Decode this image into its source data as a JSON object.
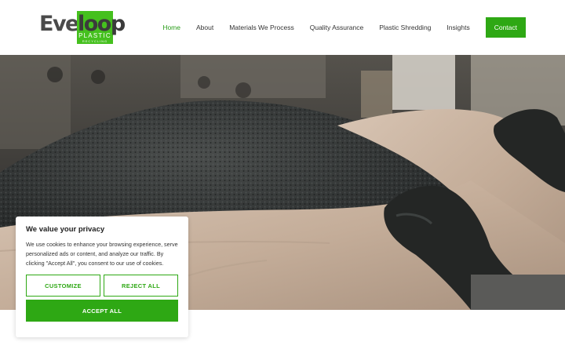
{
  "brand": {
    "logo_main": "Ever",
    "logo_box": "loop",
    "logo_sub": "PLASTIC",
    "logo_sub2": "RECYCLING",
    "accent_color": "#2ea814",
    "logo_green": "#45c01e"
  },
  "nav": {
    "items": [
      {
        "label": "Home",
        "active": true
      },
      {
        "label": "About",
        "active": false
      },
      {
        "label": "Materials We Process",
        "active": false
      },
      {
        "label": "Quality Assurance",
        "active": false
      },
      {
        "label": "Plastic Shredding",
        "active": false
      },
      {
        "label": "Insights",
        "active": false
      }
    ],
    "cta_label": "Contact"
  },
  "hero": {
    "image": "photo-of-black-plastic-granules-in-bulk-bag-with-gloved-hands"
  },
  "cookie": {
    "title": "We value your privacy",
    "body": "We use cookies to enhance your browsing experience, serve personalized ads or content, and analyze our traffic. By clicking \"Accept All\", you consent to our use of cookies.",
    "customize_label": "CUSTOMIZE",
    "reject_label": "REJECT ALL",
    "accept_label": "ACCEPT ALL"
  }
}
